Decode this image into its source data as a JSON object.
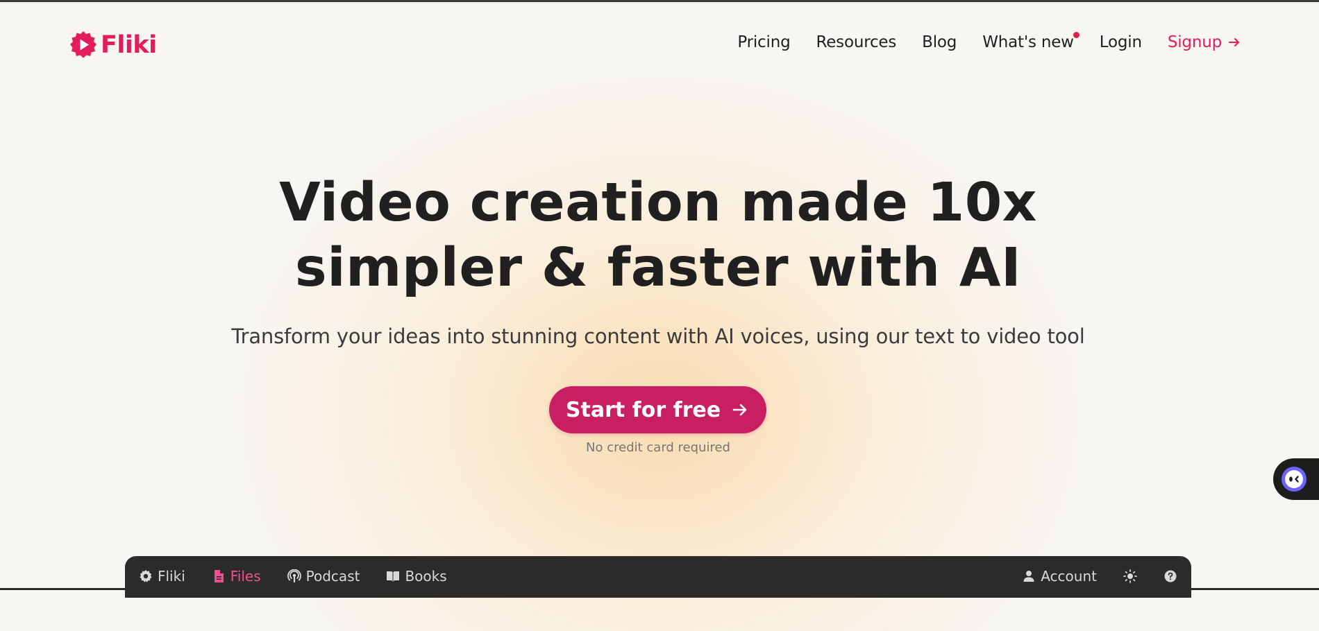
{
  "brand": {
    "name": "Fliki",
    "accent": "#e11d5c",
    "cta_color": "#c81e62"
  },
  "nav": {
    "items": [
      {
        "label": "Pricing"
      },
      {
        "label": "Resources"
      },
      {
        "label": "Blog"
      },
      {
        "label": "What's new",
        "badge": "red-dot"
      },
      {
        "label": "Login"
      }
    ],
    "signup_label": "Signup"
  },
  "hero": {
    "title_line1": "Video creation made 10x",
    "title_line2": "simpler & faster with AI",
    "subtitle": "Transform your ideas into stunning content with AI voices, using our text to video tool",
    "cta_label": "Start for free",
    "cta_note": "No credit card required"
  },
  "app_preview": {
    "tabs": [
      {
        "label": "Fliki",
        "icon": "gear-icon"
      },
      {
        "label": "Files",
        "icon": "file-icon",
        "active": true
      },
      {
        "label": "Podcast",
        "icon": "podcast-icon"
      },
      {
        "label": "Books",
        "icon": "book-icon"
      }
    ],
    "account_label": "Account",
    "right_icons": [
      "user-icon",
      "sun-icon",
      "help-icon"
    ]
  },
  "chat_widget": {
    "icon": "chat-bot-icon"
  }
}
